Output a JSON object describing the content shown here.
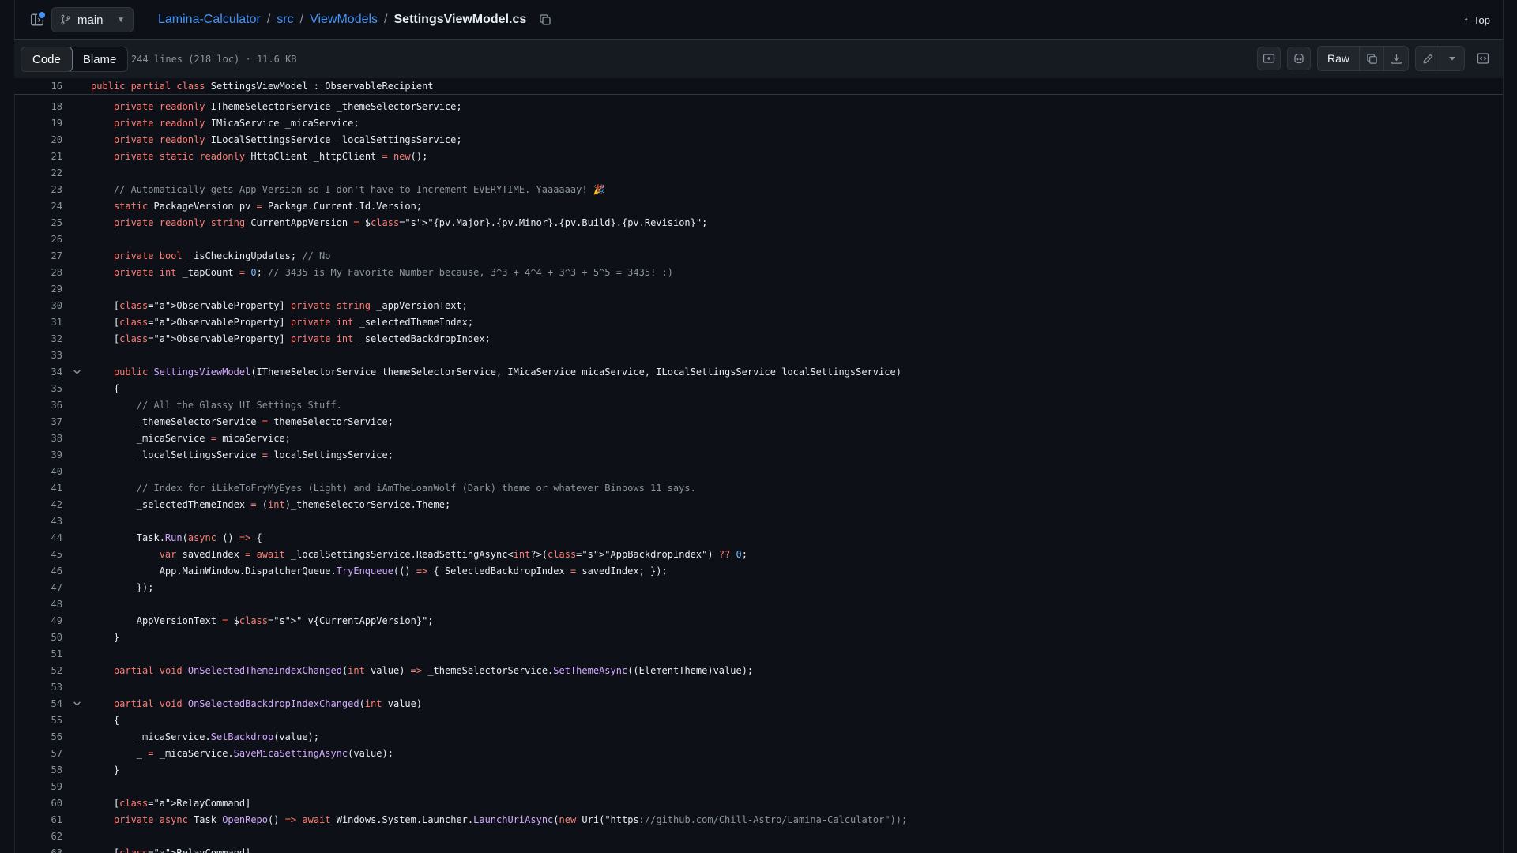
{
  "nav": {
    "branch": "main",
    "breadcrumb": [
      {
        "label": "Lamina-Calculator"
      },
      {
        "label": "src"
      },
      {
        "label": "ViewModels"
      }
    ],
    "filename": "SettingsViewModel.cs",
    "top_label": "Top"
  },
  "toolbar": {
    "tabs": [
      "Code",
      "Blame"
    ],
    "active_tab": "Code",
    "file_info": "244 lines (218 loc) · 11.6 KB",
    "raw_label": "Raw"
  },
  "sticky": {
    "line_number": "16",
    "text": "public partial class SettingsViewModel : ObservableRecipient"
  },
  "code_lines": [
    {
      "n": "18",
      "text": "    private readonly IThemeSelectorService _themeSelectorService;"
    },
    {
      "n": "19",
      "text": "    private readonly IMicaService _micaService;"
    },
    {
      "n": "20",
      "text": "    private readonly ILocalSettingsService _localSettingsService;"
    },
    {
      "n": "21",
      "text": "    private static readonly HttpClient _httpClient = new();"
    },
    {
      "n": "22",
      "text": ""
    },
    {
      "n": "23",
      "text": "    // Automatically gets App Version so I don't have to Increment EVERYTIME. Yaaaaaay! 🎉"
    },
    {
      "n": "24",
      "text": "    static PackageVersion pv = Package.Current.Id.Version;"
    },
    {
      "n": "25",
      "text": "    private readonly string CurrentAppVersion = $\"{pv.Major}.{pv.Minor}.{pv.Build}.{pv.Revision}\";"
    },
    {
      "n": "26",
      "text": ""
    },
    {
      "n": "27",
      "text": "    private bool _isCheckingUpdates; // No"
    },
    {
      "n": "28",
      "text": "    private int _tapCount = 0; // 3435 is My Favorite Number because, 3^3 + 4^4 + 3^3 + 5^5 = 3435! :)"
    },
    {
      "n": "29",
      "text": ""
    },
    {
      "n": "30",
      "text": "    [ObservableProperty] private string _appVersionText;"
    },
    {
      "n": "31",
      "text": "    [ObservableProperty] private int _selectedThemeIndex;"
    },
    {
      "n": "32",
      "text": "    [ObservableProperty] private int _selectedBackdropIndex;"
    },
    {
      "n": "33",
      "text": ""
    },
    {
      "n": "34",
      "text": "    public SettingsViewModel(IThemeSelectorService themeSelectorService, IMicaService micaService, ILocalSettingsService localSettingsService)",
      "fold": true
    },
    {
      "n": "35",
      "text": "    {"
    },
    {
      "n": "36",
      "text": "        // All the Glassy UI Settings Stuff."
    },
    {
      "n": "37",
      "text": "        _themeSelectorService = themeSelectorService;"
    },
    {
      "n": "38",
      "text": "        _micaService = micaService;"
    },
    {
      "n": "39",
      "text": "        _localSettingsService = localSettingsService;"
    },
    {
      "n": "40",
      "text": ""
    },
    {
      "n": "41",
      "text": "        // Index for iLikeToFryMyEyes (Light) and iAmTheLoanWolf (Dark) theme or whatever Binbows 11 says."
    },
    {
      "n": "42",
      "text": "        _selectedThemeIndex = (int)_themeSelectorService.Theme;"
    },
    {
      "n": "43",
      "text": ""
    },
    {
      "n": "44",
      "text": "        Task.Run(async () => {"
    },
    {
      "n": "45",
      "text": "            var savedIndex = await _localSettingsService.ReadSettingAsync<int?>(\"AppBackdropIndex\") ?? 0;"
    },
    {
      "n": "46",
      "text": "            App.MainWindow.DispatcherQueue.TryEnqueue(() => { SelectedBackdropIndex = savedIndex; });"
    },
    {
      "n": "47",
      "text": "        });"
    },
    {
      "n": "48",
      "text": ""
    },
    {
      "n": "49",
      "text": "        AppVersionText = $\" v{CurrentAppVersion}\";"
    },
    {
      "n": "50",
      "text": "    }"
    },
    {
      "n": "51",
      "text": ""
    },
    {
      "n": "52",
      "text": "    partial void OnSelectedThemeIndexChanged(int value) => _themeSelectorService.SetThemeAsync((ElementTheme)value);"
    },
    {
      "n": "53",
      "text": ""
    },
    {
      "n": "54",
      "text": "    partial void OnSelectedBackdropIndexChanged(int value)",
      "fold": true
    },
    {
      "n": "55",
      "text": "    {"
    },
    {
      "n": "56",
      "text": "        _micaService.SetBackdrop(value);"
    },
    {
      "n": "57",
      "text": "        _ = _micaService.SaveMicaSettingAsync(value);"
    },
    {
      "n": "58",
      "text": "    }"
    },
    {
      "n": "59",
      "text": ""
    },
    {
      "n": "60",
      "text": "    [RelayCommand]"
    },
    {
      "n": "61",
      "text": "    private async Task OpenRepo() => await Windows.System.Launcher.LaunchUriAsync(new Uri(\"https://github.com/Chill-Astro/Lamina-Calculator\"));"
    },
    {
      "n": "62",
      "text": ""
    },
    {
      "n": "63",
      "text": "    [RelayCommand]"
    }
  ]
}
